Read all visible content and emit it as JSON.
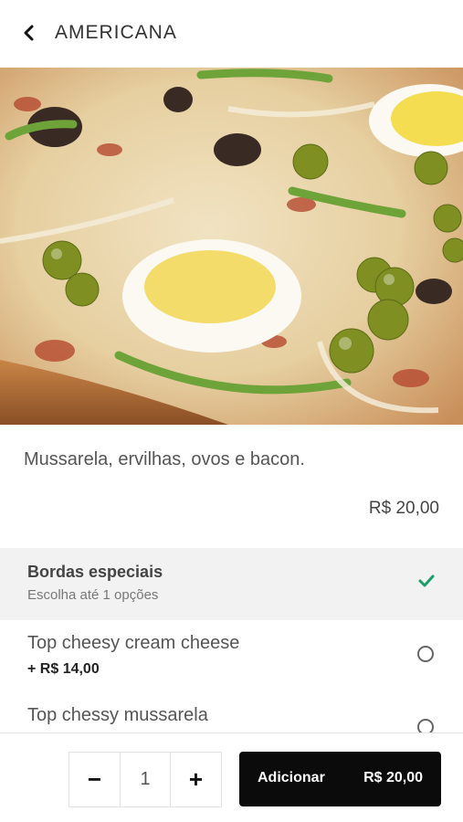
{
  "header": {
    "title": "AMERICANA",
    "back_icon": "chevron-left-icon"
  },
  "product": {
    "image_icon": "pizza-photo",
    "description": "Mussarela, ervilhas, ovos e bacon.",
    "price": "R$ 20,00"
  },
  "section": {
    "title": "Bordas especiais",
    "subtitle": "Escolha até 1 opções",
    "check_icon": "check-icon",
    "check_color": "#1a9e6a"
  },
  "options": [
    {
      "name": "Top cheesy cream cheese",
      "price": "+ R$ 14,00"
    },
    {
      "name": "Top chessy mussarela",
      "price": ""
    }
  ],
  "footer": {
    "minus_label": "−",
    "quantity": "1",
    "plus_label": "+",
    "add_label": "Adicionar",
    "add_price": "R$ 20,00"
  }
}
